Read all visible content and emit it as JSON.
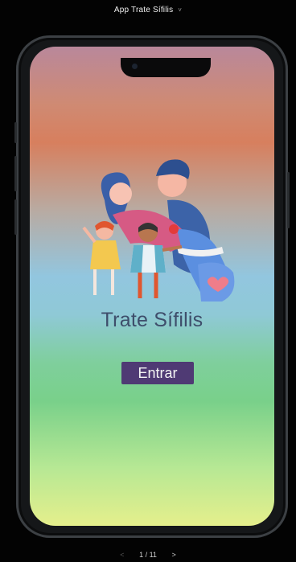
{
  "window": {
    "title": "App Trate Sífilis",
    "caret": "˅"
  },
  "app": {
    "title": "Trate Sífilis",
    "enter_label": "Entrar"
  },
  "pager": {
    "prev": "<",
    "counter": "1 / 11",
    "next": ">"
  },
  "colors": {
    "button": "#4f3a74",
    "title_text": "#3e4e6b",
    "frame": "#151719"
  },
  "icons": [
    "family-illustration",
    "heart-icon"
  ]
}
